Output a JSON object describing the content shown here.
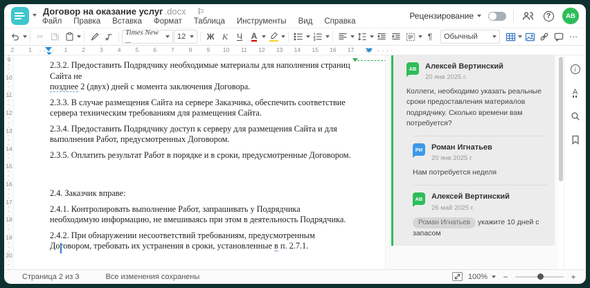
{
  "header": {
    "doc_title": "Договор на оказание услуг",
    "doc_ext": ".docx",
    "menu": [
      "Файл",
      "Правка",
      "Вставка",
      "Формат",
      "Таблица",
      "Инструменты",
      "Вид",
      "Справка"
    ],
    "review_label": "Рецензирование",
    "avatar_initials": "АВ",
    "logo_color": "#3fc6cc",
    "avatar_color": "#2ebd59"
  },
  "icons": {
    "flag": "⚐",
    "pilcrow": "¶",
    "more": "⋯",
    "minus": "−",
    "plus": "+",
    "info": "i",
    "help": "?",
    "spell_letter": "А"
  },
  "toolbar": {
    "font_family": "Times New ...",
    "font_size": "12",
    "bold": "Ж",
    "italic": "К",
    "underline": "Ч",
    "font_color_letter": "А",
    "style_name": "Обычный"
  },
  "ruler": {
    "h_numbers": [
      "2",
      "1",
      "",
      "1",
      "2",
      "3",
      "4",
      "5",
      "6",
      "7",
      "8",
      "9",
      "10",
      "11",
      "12",
      "13",
      "14",
      "15",
      "16",
      "17",
      "18"
    ],
    "v_numbers": [
      "9",
      "10",
      "11",
      "12",
      "13",
      "14",
      "15",
      "16",
      "17",
      "18",
      "19",
      "20"
    ]
  },
  "doc": {
    "p1_line1": "2.3.2. Предоставить Подрядчику необходимые материалы для наполнения страниц Сайта не",
    "p1_anchor": "позднее",
    "p1_rest": " 2 (двух) дней с момента заключения Договора.",
    "p2": "2.3.3. В случае размещения Сайта на сервере Заказчика, обеспечить соответствие сервера техническим требованиям для размещения Сайта.",
    "p3": "2.3.4. Предоставить Подрядчику доступ к серверу для размещения Сайта и для выполнения Работ, предусмотренных Договором.",
    "p4": "2.3.5. Оплатить результат Работ в порядке и в сроки, предусмотренные Договором.",
    "p5": "2.4. Заказчик вправе:",
    "p6": "2.4.1. Контролировать выполнение Работ, запрашивать у Подрядчика необходимую информацию, не вмешиваясь при этом в деятельность Подрядчика.",
    "p7_a": "2.4.2. При обнаружении несоответствий требованиям, предусмотренным Договором, требовать их устранения в сроки, установленные ",
    "p7_anchor": "в",
    "p7_rest": " п. 2.7.1."
  },
  "comments": {
    "c1": {
      "initials": "АВ",
      "name": "Алексей Вертинский",
      "date": "20 янв 2025 г.",
      "text": "Коллеги, необходимо указать реальные сроки предоставления материалов подрядчику. Сколько времени вам потребуется?"
    },
    "c2": {
      "initials": "РИ",
      "name": "Роман Игнатьев",
      "date": "20 янв 2025 г.",
      "text": "Нам потребуется неделя"
    },
    "c3": {
      "initials": "АВ",
      "name": "Алексей Вертинский",
      "date": "26 май 2025 г.",
      "mention": "Роман Игнатьев",
      "text": "укажите 10 дней с запасом"
    }
  },
  "statusbar": {
    "page": "Страница 2 из 3",
    "saved": "Все изменения сохранены",
    "zoom": "100%"
  }
}
